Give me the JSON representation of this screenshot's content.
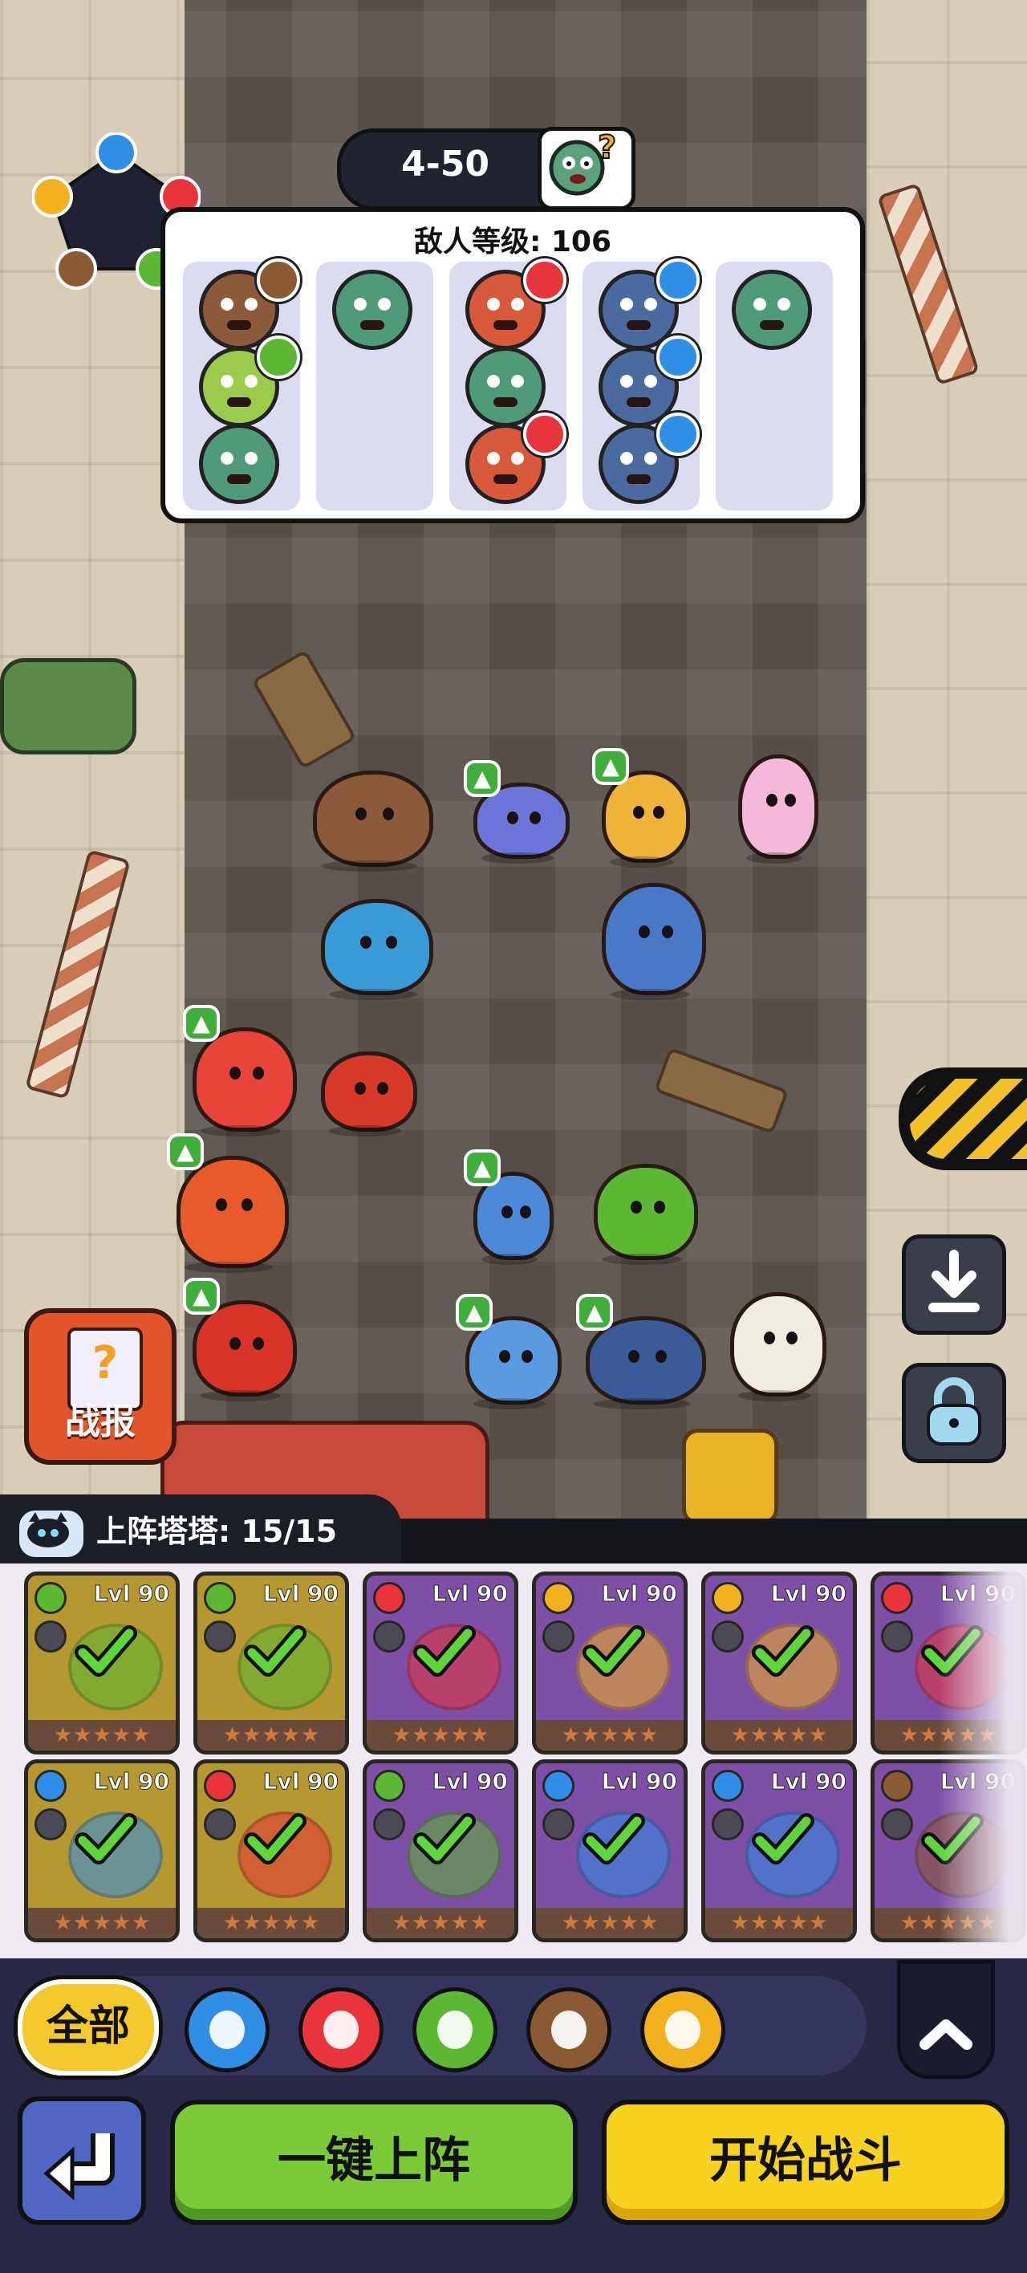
{
  "stage": {
    "label": "4-50",
    "icon": "zombie-question-icon"
  },
  "enemy_panel": {
    "title": "敌人等级: 106",
    "columns": [
      {
        "enemies": [
          "bear-enemy",
          "leaf-enemy",
          "zombie-enemy"
        ],
        "elements": [
          "earth",
          "leaf",
          null
        ]
      },
      {
        "enemies": [
          "zombie-enemy"
        ],
        "elements": [
          null
        ]
      },
      {
        "enemies": [
          "fire-enemy",
          "zombie-enemy",
          "fire-enemy"
        ],
        "elements": [
          "fire",
          null,
          "fire"
        ]
      },
      {
        "enemies": [
          "water-zombie-enemy",
          "water-zombie-enemy",
          "water-zombie-enemy"
        ],
        "elements": [
          "water",
          "water",
          "water"
        ]
      },
      {
        "enemies": [
          "zombie-enemy"
        ],
        "elements": [
          null
        ]
      }
    ]
  },
  "side_buttons": {
    "report_label": "战报",
    "report_icon": "question-clipboard-icon",
    "download_icon": "download-icon",
    "lock_icon": "lock-icon"
  },
  "roster": {
    "title": "上阵塔塔: 15/15",
    "cat_icon": "cat-icon",
    "cards": [
      {
        "level": "Lvl 90",
        "element": "leaf",
        "stars": 5,
        "bg": "#b59830",
        "deployed": true
      },
      {
        "level": "Lvl 90",
        "element": "leaf",
        "stars": 5,
        "bg": "#b59830",
        "deployed": true
      },
      {
        "level": "Lvl 90",
        "element": "fire",
        "stars": 5,
        "bg": "#7e4fa6",
        "deployed": true
      },
      {
        "level": "Lvl 90",
        "element": "lightning",
        "stars": 5,
        "bg": "#7e4fa6",
        "deployed": true
      },
      {
        "level": "Lvl 90",
        "element": "lightning",
        "stars": 5,
        "bg": "#7e4fa6",
        "deployed": true
      },
      {
        "level": "Lvl 90",
        "element": "fire",
        "stars": 5,
        "bg": "#7e4fa6",
        "deployed": true
      },
      {
        "level": "Lvl 90",
        "element": "water",
        "stars": 5,
        "bg": "#b59830",
        "deployed": true
      },
      {
        "level": "Lvl 90",
        "element": "fire",
        "stars": 5,
        "bg": "#b59830",
        "deployed": true
      },
      {
        "level": "Lvl 90",
        "element": "leaf",
        "stars": 5,
        "bg": "#7e4fa6",
        "deployed": true
      },
      {
        "level": "Lvl 90",
        "element": "water",
        "stars": 5,
        "bg": "#7e4fa6",
        "deployed": true
      },
      {
        "level": "Lvl 90",
        "element": "water",
        "stars": 5,
        "bg": "#7e4fa6",
        "deployed": true
      },
      {
        "level": "Lvl 90",
        "element": "earth",
        "stars": 5,
        "bg": "#7e4fa6",
        "deployed": true
      }
    ]
  },
  "filters": {
    "all_label": "全部",
    "items": [
      "water",
      "fire",
      "leaf",
      "earth",
      "lightning"
    ]
  },
  "actions": {
    "back_icon": "back-arrow-icon",
    "expand_icon": "chevron-up-icon",
    "deploy_label": "一键上阵",
    "start_label": "开始战斗"
  },
  "colors": {
    "water": "#2f8fe6",
    "fire": "#e8343a",
    "leaf": "#5cb833",
    "earth": "#8a5a32",
    "lightning": "#f2b21e"
  }
}
